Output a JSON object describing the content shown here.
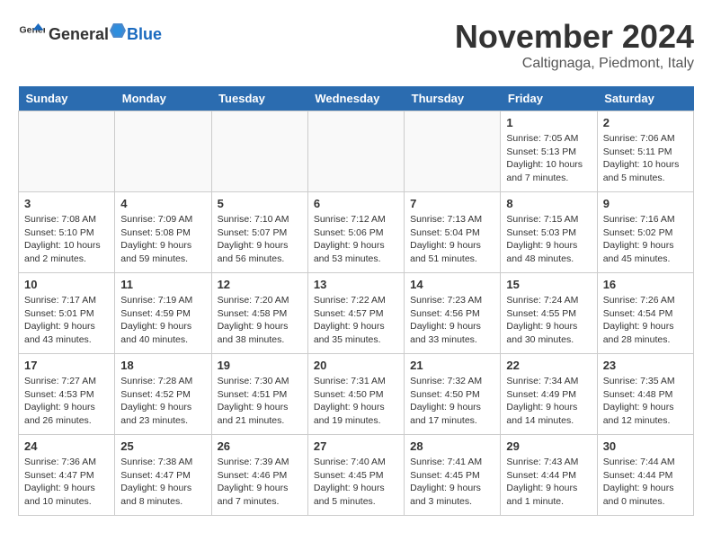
{
  "header": {
    "logo_general": "General",
    "logo_blue": "Blue",
    "month_title": "November 2024",
    "location": "Caltignaga, Piedmont, Italy"
  },
  "weekdays": [
    "Sunday",
    "Monday",
    "Tuesday",
    "Wednesday",
    "Thursday",
    "Friday",
    "Saturday"
  ],
  "weeks": [
    [
      {
        "day": "",
        "info": ""
      },
      {
        "day": "",
        "info": ""
      },
      {
        "day": "",
        "info": ""
      },
      {
        "day": "",
        "info": ""
      },
      {
        "day": "",
        "info": ""
      },
      {
        "day": "1",
        "info": "Sunrise: 7:05 AM\nSunset: 5:13 PM\nDaylight: 10 hours\nand 7 minutes."
      },
      {
        "day": "2",
        "info": "Sunrise: 7:06 AM\nSunset: 5:11 PM\nDaylight: 10 hours\nand 5 minutes."
      }
    ],
    [
      {
        "day": "3",
        "info": "Sunrise: 7:08 AM\nSunset: 5:10 PM\nDaylight: 10 hours\nand 2 minutes."
      },
      {
        "day": "4",
        "info": "Sunrise: 7:09 AM\nSunset: 5:08 PM\nDaylight: 9 hours\nand 59 minutes."
      },
      {
        "day": "5",
        "info": "Sunrise: 7:10 AM\nSunset: 5:07 PM\nDaylight: 9 hours\nand 56 minutes."
      },
      {
        "day": "6",
        "info": "Sunrise: 7:12 AM\nSunset: 5:06 PM\nDaylight: 9 hours\nand 53 minutes."
      },
      {
        "day": "7",
        "info": "Sunrise: 7:13 AM\nSunset: 5:04 PM\nDaylight: 9 hours\nand 51 minutes."
      },
      {
        "day": "8",
        "info": "Sunrise: 7:15 AM\nSunset: 5:03 PM\nDaylight: 9 hours\nand 48 minutes."
      },
      {
        "day": "9",
        "info": "Sunrise: 7:16 AM\nSunset: 5:02 PM\nDaylight: 9 hours\nand 45 minutes."
      }
    ],
    [
      {
        "day": "10",
        "info": "Sunrise: 7:17 AM\nSunset: 5:01 PM\nDaylight: 9 hours\nand 43 minutes."
      },
      {
        "day": "11",
        "info": "Sunrise: 7:19 AM\nSunset: 4:59 PM\nDaylight: 9 hours\nand 40 minutes."
      },
      {
        "day": "12",
        "info": "Sunrise: 7:20 AM\nSunset: 4:58 PM\nDaylight: 9 hours\nand 38 minutes."
      },
      {
        "day": "13",
        "info": "Sunrise: 7:22 AM\nSunset: 4:57 PM\nDaylight: 9 hours\nand 35 minutes."
      },
      {
        "day": "14",
        "info": "Sunrise: 7:23 AM\nSunset: 4:56 PM\nDaylight: 9 hours\nand 33 minutes."
      },
      {
        "day": "15",
        "info": "Sunrise: 7:24 AM\nSunset: 4:55 PM\nDaylight: 9 hours\nand 30 minutes."
      },
      {
        "day": "16",
        "info": "Sunrise: 7:26 AM\nSunset: 4:54 PM\nDaylight: 9 hours\nand 28 minutes."
      }
    ],
    [
      {
        "day": "17",
        "info": "Sunrise: 7:27 AM\nSunset: 4:53 PM\nDaylight: 9 hours\nand 26 minutes."
      },
      {
        "day": "18",
        "info": "Sunrise: 7:28 AM\nSunset: 4:52 PM\nDaylight: 9 hours\nand 23 minutes."
      },
      {
        "day": "19",
        "info": "Sunrise: 7:30 AM\nSunset: 4:51 PM\nDaylight: 9 hours\nand 21 minutes."
      },
      {
        "day": "20",
        "info": "Sunrise: 7:31 AM\nSunset: 4:50 PM\nDaylight: 9 hours\nand 19 minutes."
      },
      {
        "day": "21",
        "info": "Sunrise: 7:32 AM\nSunset: 4:50 PM\nDaylight: 9 hours\nand 17 minutes."
      },
      {
        "day": "22",
        "info": "Sunrise: 7:34 AM\nSunset: 4:49 PM\nDaylight: 9 hours\nand 14 minutes."
      },
      {
        "day": "23",
        "info": "Sunrise: 7:35 AM\nSunset: 4:48 PM\nDaylight: 9 hours\nand 12 minutes."
      }
    ],
    [
      {
        "day": "24",
        "info": "Sunrise: 7:36 AM\nSunset: 4:47 PM\nDaylight: 9 hours\nand 10 minutes."
      },
      {
        "day": "25",
        "info": "Sunrise: 7:38 AM\nSunset: 4:47 PM\nDaylight: 9 hours\nand 8 minutes."
      },
      {
        "day": "26",
        "info": "Sunrise: 7:39 AM\nSunset: 4:46 PM\nDaylight: 9 hours\nand 7 minutes."
      },
      {
        "day": "27",
        "info": "Sunrise: 7:40 AM\nSunset: 4:45 PM\nDaylight: 9 hours\nand 5 minutes."
      },
      {
        "day": "28",
        "info": "Sunrise: 7:41 AM\nSunset: 4:45 PM\nDaylight: 9 hours\nand 3 minutes."
      },
      {
        "day": "29",
        "info": "Sunrise: 7:43 AM\nSunset: 4:44 PM\nDaylight: 9 hours\nand 1 minute."
      },
      {
        "day": "30",
        "info": "Sunrise: 7:44 AM\nSunset: 4:44 PM\nDaylight: 9 hours\nand 0 minutes."
      }
    ]
  ]
}
